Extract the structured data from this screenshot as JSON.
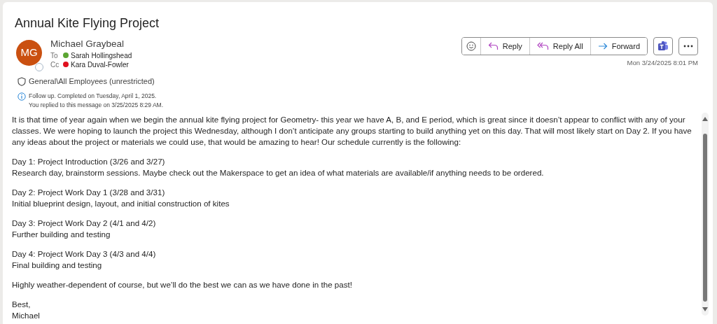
{
  "subject": "Annual Kite Flying Project",
  "sender": {
    "initials": "MG",
    "name": "Michael Graybeal"
  },
  "recipients": [
    {
      "label": "To",
      "name": "Sarah Hollingshead",
      "color": "#5ba532"
    },
    {
      "label": "Cc",
      "name": "Kara Duval-Fowler",
      "color": "#e0101e"
    }
  ],
  "sensitivity": "General\\All Employees (unrestricted)",
  "info": [
    "Follow up.  Completed on Tuesday, April 1, 2025.",
    "You replied to this message on 3/25/2025 8:29 AM."
  ],
  "actions": [
    {
      "kind": "emoji"
    },
    {
      "kind": "reply",
      "label": "Reply"
    },
    {
      "kind": "reply_all",
      "label": "Reply All"
    },
    {
      "kind": "forward",
      "label": "Forward"
    }
  ],
  "date": "Mon 3/24/2025 8:01 PM",
  "body": [
    [
      "It is that time of year again when we begin the annual kite flying project for Geometry- this year we have A, B, and E period, which is great since it doesn’t appear to conflict with any of your classes. We were hoping to launch the project this Wednesday, although I don’t anticipate any groups starting to build anything yet on this day. That will most likely start on Day 2. If you have any ideas about the project or materials we could use, that would be amazing to hear! Our schedule currently is the following:"
    ],
    [
      "Day 1: Project Introduction (3/26 and 3/27)",
      "Research day, brainstorm sessions. Maybe check out the Makerspace to get an idea of what materials are available/if anything needs to be ordered."
    ],
    [
      "Day 2: Project Work Day 1 (3/28 and 3/31)",
      "Initial blueprint design, layout, and initial construction of kites"
    ],
    [
      "Day 3: Project Work Day 2 (4/1 and 4/2)",
      "Further building and testing"
    ],
    [
      "Day 4: Project Work Day 3 (4/3 and 4/4)",
      "Final building and testing"
    ],
    [
      "Highly weather-dependent of course, but we’ll do the best we can as we have done in the past!"
    ],
    [
      "Best,",
      "Michael"
    ]
  ]
}
